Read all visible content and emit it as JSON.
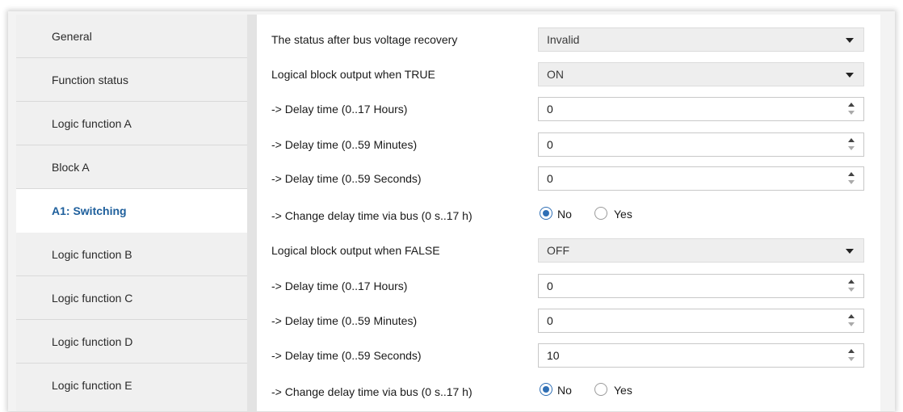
{
  "sidebar": {
    "items": [
      {
        "label": "General"
      },
      {
        "label": "Function status"
      },
      {
        "label": "Logic function A"
      },
      {
        "label": "Block A"
      },
      {
        "label": "A1: Switching",
        "active": true
      },
      {
        "label": "Logic function B"
      },
      {
        "label": "Logic function C"
      },
      {
        "label": "Logic function D"
      },
      {
        "label": "Logic function E"
      }
    ]
  },
  "main": {
    "rows": [
      {
        "label": "The status after bus voltage recovery",
        "type": "select",
        "value": "Invalid"
      },
      {
        "label": "Logical block output when TRUE",
        "type": "select",
        "value": "ON"
      },
      {
        "label": "-> Delay time (0..17 Hours)",
        "type": "spin",
        "value": "0"
      },
      {
        "label": "-> Delay time (0..59 Minutes)",
        "type": "spin",
        "value": "0"
      },
      {
        "label": "-> Delay time (0..59 Seconds)",
        "type": "spin",
        "value": "0"
      },
      {
        "label": "-> Change delay time via bus (0 s..17 h)",
        "type": "radio",
        "options": [
          "No",
          "Yes"
        ],
        "selected": "No"
      },
      {
        "label": "Logical block output when FALSE",
        "type": "select",
        "value": "OFF"
      },
      {
        "label": "-> Delay time (0..17 Hours)",
        "type": "spin",
        "value": "0"
      },
      {
        "label": "-> Delay time (0..59 Minutes)",
        "type": "spin",
        "value": "0"
      },
      {
        "label": "-> Delay time (0..59 Seconds)",
        "type": "spin",
        "value": "10"
      },
      {
        "label": "-> Change delay time via bus (0 s..17 h)",
        "type": "radio",
        "options": [
          "No",
          "Yes"
        ],
        "selected": "No"
      }
    ]
  },
  "colors": {
    "accent": "#2f6fb5",
    "active_text": "#1e5f9c"
  }
}
